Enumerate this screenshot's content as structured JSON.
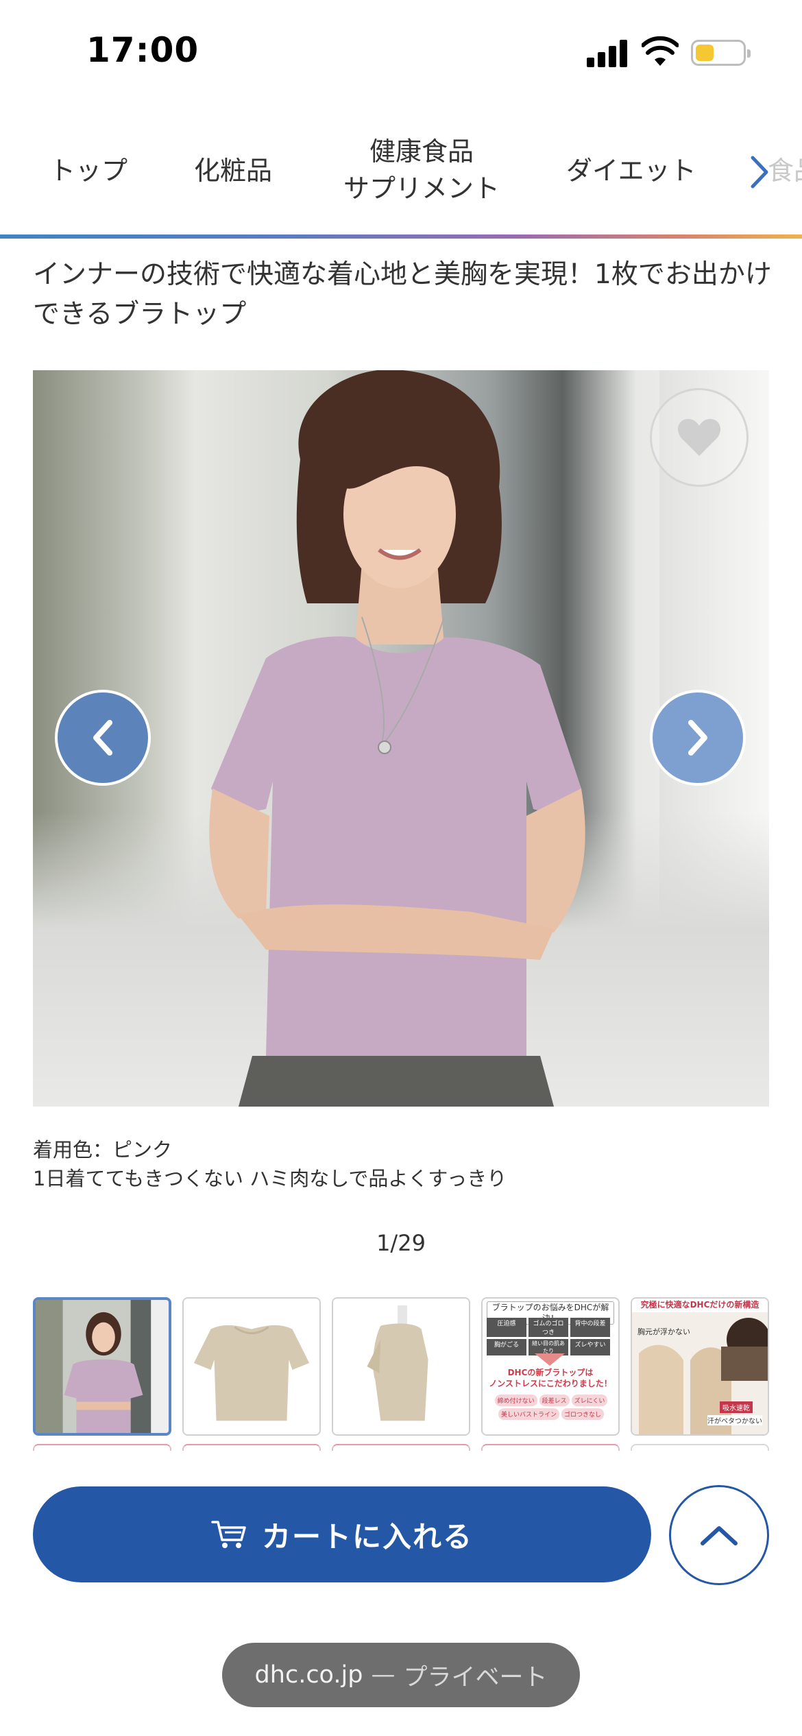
{
  "status_bar": {
    "time": "17:00"
  },
  "nav": {
    "tabs": [
      {
        "label": "トップ"
      },
      {
        "label": "化粧品"
      },
      {
        "label_line1": "健康食品",
        "label_line2": "サプリメント"
      },
      {
        "label": "ダイエット"
      },
      {
        "label": "食品"
      }
    ],
    "next_icon": "chevron-right-icon"
  },
  "product": {
    "title": "インナーの技術で快適な着心地と美胸を実現！1枚でお出かけできるブラトップ",
    "caption_line1": "着用色：ピンク",
    "caption_line2": "1日着ててもきつくない ハミ肉なしで品よくすっきり",
    "image_counter": "1/29"
  },
  "thumbnails": {
    "items": [
      {
        "name": "model-photo"
      },
      {
        "name": "front-view"
      },
      {
        "name": "side-view"
      },
      {
        "name": "feature-chart",
        "header": "ブラトップのお悩みをDHCが解決！",
        "tags": [
          "圧迫感",
          "ゴムのゴロつき",
          "背中の段差",
          "胸がごる",
          "縫い目の肌あたり",
          "ズレやすい"
        ],
        "headline_line1": "DHCの新ブラトップは",
        "headline_line2": "ノンストレスにこだわりました！",
        "badges": [
          "締め付けない",
          "段差レス",
          "ズレにくい",
          "美しいバストライン",
          "ゴロつきなし"
        ]
      },
      {
        "name": "structure-photo",
        "header": "究極に快適なDHCだけの新構造",
        "label1": "胸元が浮かない",
        "badge": "吸水速乾",
        "label2": "汗がベタつかない"
      }
    ]
  },
  "actions": {
    "cart_label": "カートに入れる",
    "cart_icon": "cart-icon",
    "scroll_top_icon": "chevron-up-icon",
    "favorite_icon": "heart-icon",
    "prev_icon": "chevron-left-icon",
    "next_icon": "chevron-right-icon"
  },
  "browser": {
    "domain": "dhc.co.jp",
    "separator": "—",
    "mode": "プライベート"
  },
  "colors": {
    "accent": "#2457a6",
    "arrow_button": "#6f93c4",
    "active_thumb_border": "#5b86c6",
    "url_pill": "#6e6e6e"
  }
}
